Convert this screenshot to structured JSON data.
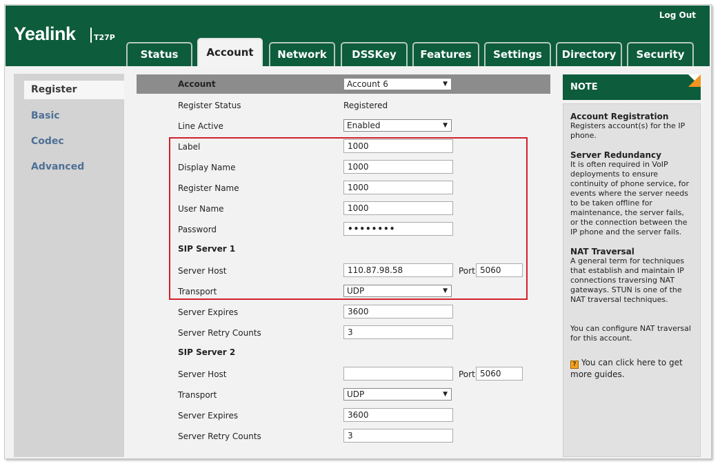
{
  "header": {
    "brand": "Yealink",
    "model": "T27P",
    "logout": "Log Out"
  },
  "tabs": [
    {
      "label": "Status"
    },
    {
      "label": "Account"
    },
    {
      "label": "Network"
    },
    {
      "label": "DSSKey"
    },
    {
      "label": "Features"
    },
    {
      "label": "Settings"
    },
    {
      "label": "Directory"
    },
    {
      "label": "Security"
    }
  ],
  "sidebar": {
    "items": [
      {
        "label": "Register"
      },
      {
        "label": "Basic"
      },
      {
        "label": "Codec"
      },
      {
        "label": "Advanced"
      }
    ]
  },
  "form": {
    "account_label": "Account",
    "account_value": "Account 6",
    "register_status_label": "Register Status",
    "register_status_value": "Registered",
    "line_active_label": "Line Active",
    "line_active_value": "Enabled",
    "label_label": "Label",
    "label_value": "1000",
    "display_name_label": "Display Name",
    "display_name_value": "1000",
    "register_name_label": "Register Name",
    "register_name_value": "1000",
    "user_name_label": "User Name",
    "user_name_value": "1000",
    "password_label": "Password",
    "password_value": "••••••••",
    "sip1": {
      "title": "SIP Server 1",
      "host_label": "Server Host",
      "host_value": "110.87.98.58",
      "port_label": "Port",
      "port_value": "5060",
      "transport_label": "Transport",
      "transport_value": "UDP",
      "expires_label": "Server Expires",
      "expires_value": "3600",
      "retry_label": "Server Retry Counts",
      "retry_value": "3"
    },
    "sip2": {
      "title": "SIP Server 2",
      "host_label": "Server Host",
      "host_value": "",
      "port_label": "Port",
      "port_value": "5060",
      "transport_label": "Transport",
      "transport_value": "UDP",
      "expires_label": "Server Expires",
      "expires_value": "3600",
      "retry_label": "Server Retry Counts",
      "retry_value": "3"
    }
  },
  "note": {
    "title": "NOTE",
    "sections": [
      {
        "heading": "Account Registration",
        "text": "Registers account(s) for the IP phone."
      },
      {
        "heading": "Server Redundancy",
        "text": "It is often required in VoIP deployments to ensure continuity of phone service, for events where the server needs to be taken offline for maintenance, the server fails, or the connection between the IP phone and the server fails."
      },
      {
        "heading": "NAT Traversal",
        "text": "A general term for techniques that establish and maintain IP connections traversing NAT gateways. STUN is one of the NAT traversal techniques."
      }
    ],
    "nat_config": "You can configure NAT traversal for this account.",
    "guide_icon_glyph": "?",
    "guide_text": "You can click here to get more guides."
  },
  "colors": {
    "brand_green": "#0d5c3c",
    "accent_orange": "#f39420",
    "highlight_red": "#d0202b",
    "nav_link": "#4f6f96"
  }
}
